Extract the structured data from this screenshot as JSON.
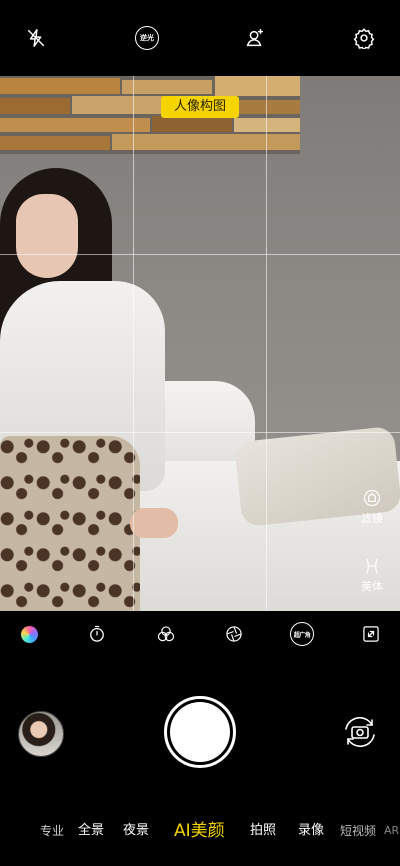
{
  "top_bar": {
    "icons": [
      "flash-off-icon",
      "backlight-icon",
      "portrait-composition-icon",
      "settings-icon"
    ],
    "backlight_label": "逆光"
  },
  "viewfinder": {
    "mode_tag": "人像构图",
    "side_controls": [
      {
        "icon": "filter-icon",
        "label": "滤镜"
      },
      {
        "icon": "body-beauty-icon",
        "label": "美体"
      }
    ]
  },
  "toolbar": {
    "icons": [
      "color-style-icon",
      "timer-icon",
      "live-filter-icon",
      "aperture-icon",
      "wide-angle-icon",
      "expand-icon"
    ],
    "wide_label": "超广角"
  },
  "capture": {
    "thumbnail": "last-photo-thumbnail",
    "shutter": "shutter-button",
    "flip": "switch-camera-icon"
  },
  "modes": {
    "items": [
      "专业",
      "全景",
      "夜景",
      "AI美颜",
      "拍照",
      "录像",
      "短视频",
      "AR"
    ],
    "active_index": 3,
    "accent": "#f5d400"
  }
}
